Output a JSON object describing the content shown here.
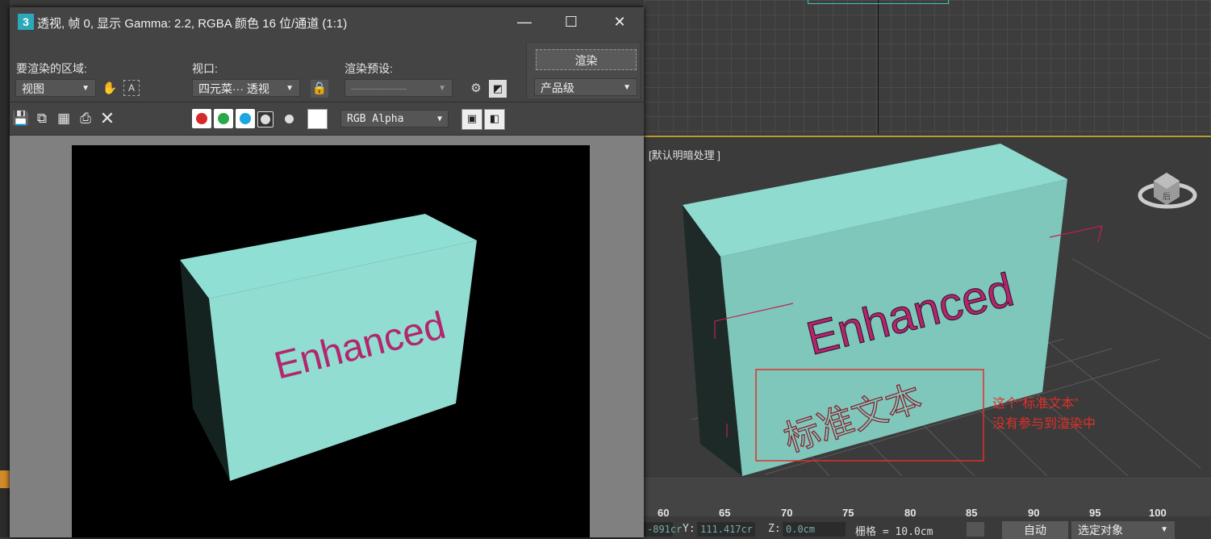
{
  "frame_window": {
    "app_icon": "3",
    "title": "透视, 帧 0, 显示 Gamma: 2.2, RGBA 颜色 16 位/通道 (1:1)",
    "controls": {
      "minimize": "—",
      "maximize": "☐",
      "close": "✕"
    }
  },
  "render_options": {
    "area_label": "要渲染的区域:",
    "area_value": "视图",
    "viewport_label": "视口:",
    "viewport_value": "四元菜··· 透视",
    "preset_label": "渲染预设:",
    "preset_value": "-----------------------",
    "render_button": "渲染",
    "quality_value": "产品级"
  },
  "toolbar": {
    "channel_display": "RGB Alpha",
    "channel_colors": {
      "red": "#d62a2a",
      "green": "#2aa84a",
      "blue": "#1aa6e0"
    }
  },
  "rendered_image": {
    "text": "Enhanced",
    "box_color": "#90dfd4",
    "text_color": "#b2266e"
  },
  "viewport": {
    "label": "[默认明暗处理 ]",
    "model_text": "Enhanced",
    "standard_text": "标准文本",
    "viewcube_label": "后",
    "annotation_line1": "这个“标准文本”",
    "annotation_line2": "没有参与到渲染中",
    "annotation_color": "#e0302a"
  },
  "timeline": {
    "ticks": [
      "60",
      "65",
      "70",
      "75",
      "80",
      "85",
      "90",
      "95",
      "100"
    ]
  },
  "status_bar": {
    "x_value": "-891cr",
    "y_label": "Y:",
    "y_value": "111.417cr",
    "z_label": "Z:",
    "z_value": "0.0cm",
    "grid_text": "栅格 = 10.0cm",
    "auto_button": "自动",
    "selection_value": "选定对象"
  }
}
